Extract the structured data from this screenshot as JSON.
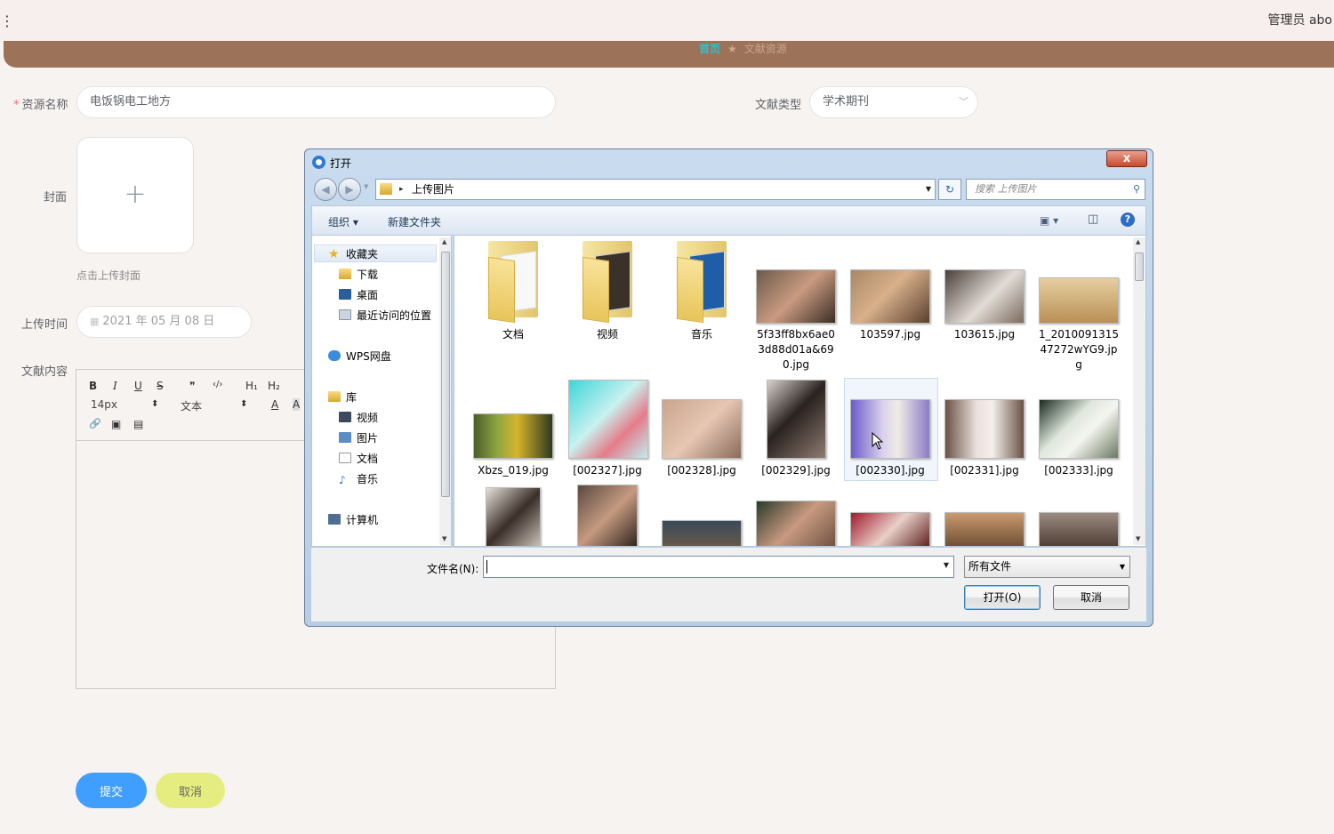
{
  "header": {
    "menu_glyph": "⋮",
    "admin_text": "管理员 abo",
    "breadcrumb_home": "首页",
    "breadcrumb_sep": "★",
    "breadcrumb_current": "文献资源"
  },
  "form": {
    "name_label": "资源名称",
    "name_required": "*",
    "name_value": "电饭锅电工地方",
    "type_label": "文献类型",
    "type_value": "学术期刊",
    "cover_label": "封面",
    "cover_plus": "+",
    "cover_hint": "点击上传封面",
    "time_label": "上传时间",
    "time_value": "2021 年 05 月 08 日",
    "content_label": "文献内容",
    "editor": {
      "bold": "B",
      "italic": "I",
      "underline": "U",
      "strike": "S",
      "quote": "❞",
      "code": "‹/›",
      "h1": "H₁",
      "h2": "H₂",
      "font_size": "14px",
      "font_size_arrows": "⬍",
      "text_style": "文本",
      "text_style_arrows": "⬍",
      "color": "A",
      "bg_color": "A",
      "link": "🔗",
      "image": "▣",
      "video": "▤"
    },
    "submit_label": "提交",
    "cancel_label": "取消"
  },
  "dialog": {
    "title": "打开",
    "close": "x",
    "back": "◀",
    "forward": "▶",
    "address": "上传图片",
    "address_arrow": "▸",
    "dropdown": "▼",
    "refresh": "↻",
    "search_placeholder": "搜索 上传图片",
    "search_icon": "⚲",
    "organize": "组织 ▾",
    "new_folder": "新建文件夹",
    "views": "▣ ▾",
    "pane_toggle": "◫",
    "help": "?",
    "nav": {
      "favorites": "收藏夹",
      "downloads": "下载",
      "desktop": "桌面",
      "recent": "最近访问的位置",
      "wps": "WPS网盘",
      "library": "库",
      "videos": "视频",
      "pictures": "图片",
      "documents": "文档",
      "music": "音乐",
      "computer": "计算机"
    },
    "files_row1": [
      "文档",
      "视频",
      "音乐",
      "5f33ff8bx6ae03d88d01a&690.jpg",
      "103597.jpg",
      "103615.jpg",
      "1_201009131547272wYG9.jpg"
    ],
    "files_row2": [
      "Xbzs_019.jpg",
      "[002327].jpg",
      "[002328].jpg",
      "[002329].jpg",
      "[002330].jpg",
      "[002331].jpg",
      "[002333].jpg"
    ],
    "filename_label": "文件名(N):",
    "filetype_value": "所有文件",
    "open_label": "打开(O)",
    "cancel_label": "取消",
    "scroll_up": "▲",
    "scroll_down": "▼"
  }
}
